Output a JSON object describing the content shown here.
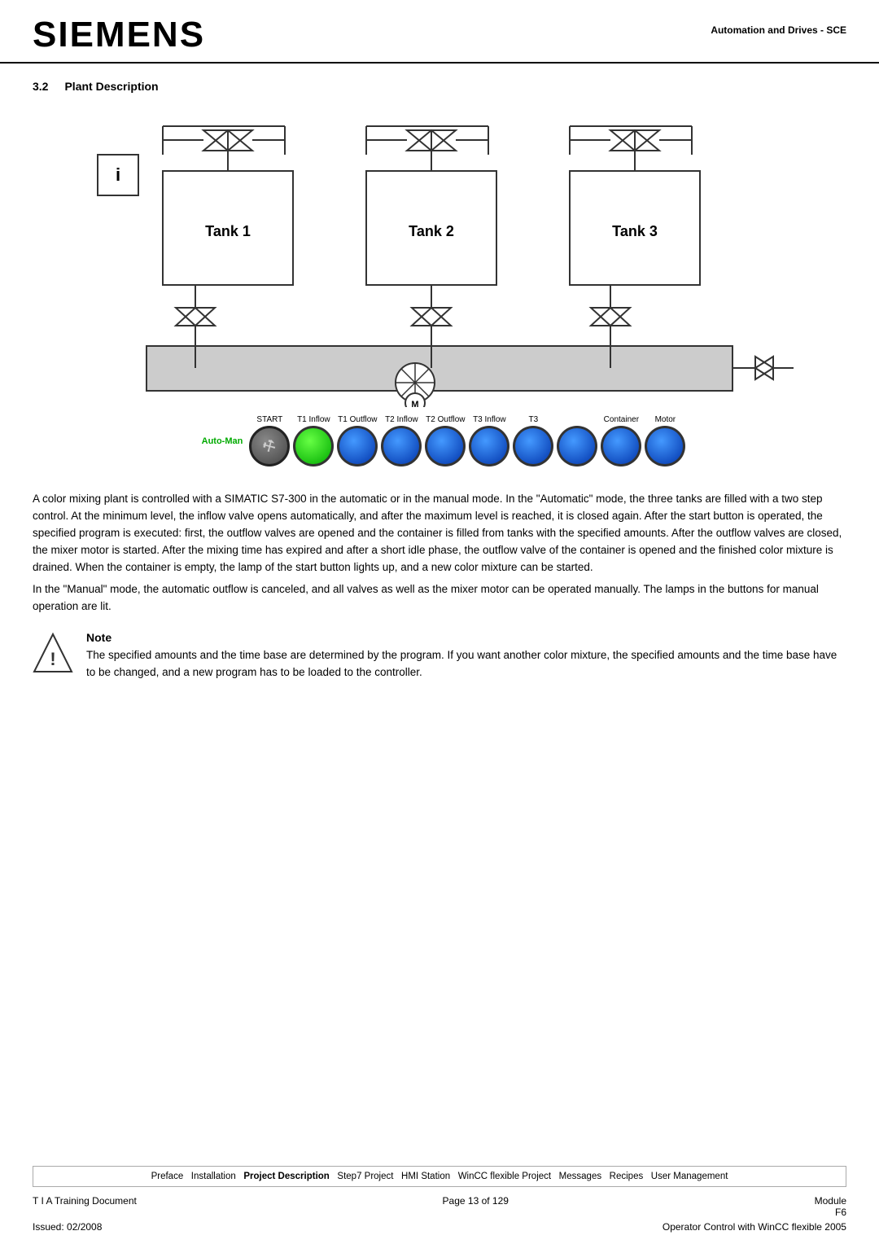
{
  "header": {
    "logo": "SIEMENS",
    "subtitle": "Automation and Drives - SCE"
  },
  "section": {
    "number": "3.2",
    "title": "Plant Description"
  },
  "tanks": [
    {
      "label": "Tank 1"
    },
    {
      "label": "Tank 2"
    },
    {
      "label": "Tank 3"
    }
  ],
  "control_panel": {
    "auto_man_label": "Auto-Man",
    "labels": [
      "START",
      "T1 Inflow",
      "T1 Outflow",
      "T2 Inflow",
      "T2 Outflow",
      "T3 Inflow",
      "T3",
      "",
      "Container",
      "Motor"
    ],
    "buttons": [
      "key",
      "green",
      "blue",
      "blue",
      "blue",
      "blue",
      "blue",
      "blue",
      "blue",
      "blue"
    ]
  },
  "description": "A color mixing plant is controlled with a SIMATIC S7-300 in the automatic or in the manual mode. In the \"Automatic\" mode, the three tanks are filled with a two step control.  At the minimum level, the inflow valve opens automatically, and after the maximum level is reached, it is closed again. After the start button is operated, the specified program is executed: first, the outflow valves are opened and the container is filled from tanks with the specified amounts. After the outflow valves are closed, the mixer motor is started. After the mixing time has expired and after a short idle phase, the outflow valve of the container is opened and the finished color mixture is drained.  When the container is empty, the lamp of the start button lights up, and a new color mixture can be started.\nIn the \"Manual\" mode, the automatic outflow is canceled, and all valves as well as the mixer motor can be operated manually. The lamps in the buttons for manual operation are lit.",
  "note": {
    "title": "Note",
    "text": "The specified amounts and the time base are determined by the program. If you want another color mixture, the specified amounts and the time base have to be changed, and a new program has to be loaded to the controller."
  },
  "footer_nav": {
    "text": "Preface  Installation  Project Description  Step7 Project  HMI Station  WinCC flexible Project  Messages  Recipes  User Management",
    "bold_item": "Project Description"
  },
  "footer_bottom": {
    "left1": "T I A  Training Document",
    "center1": "Page 13 of 129",
    "right1": "Module",
    "right1b": "F6",
    "left2": "Issued: 02/2008",
    "center2": "",
    "right2": "Operator Control with WinCC flexible 2005"
  }
}
